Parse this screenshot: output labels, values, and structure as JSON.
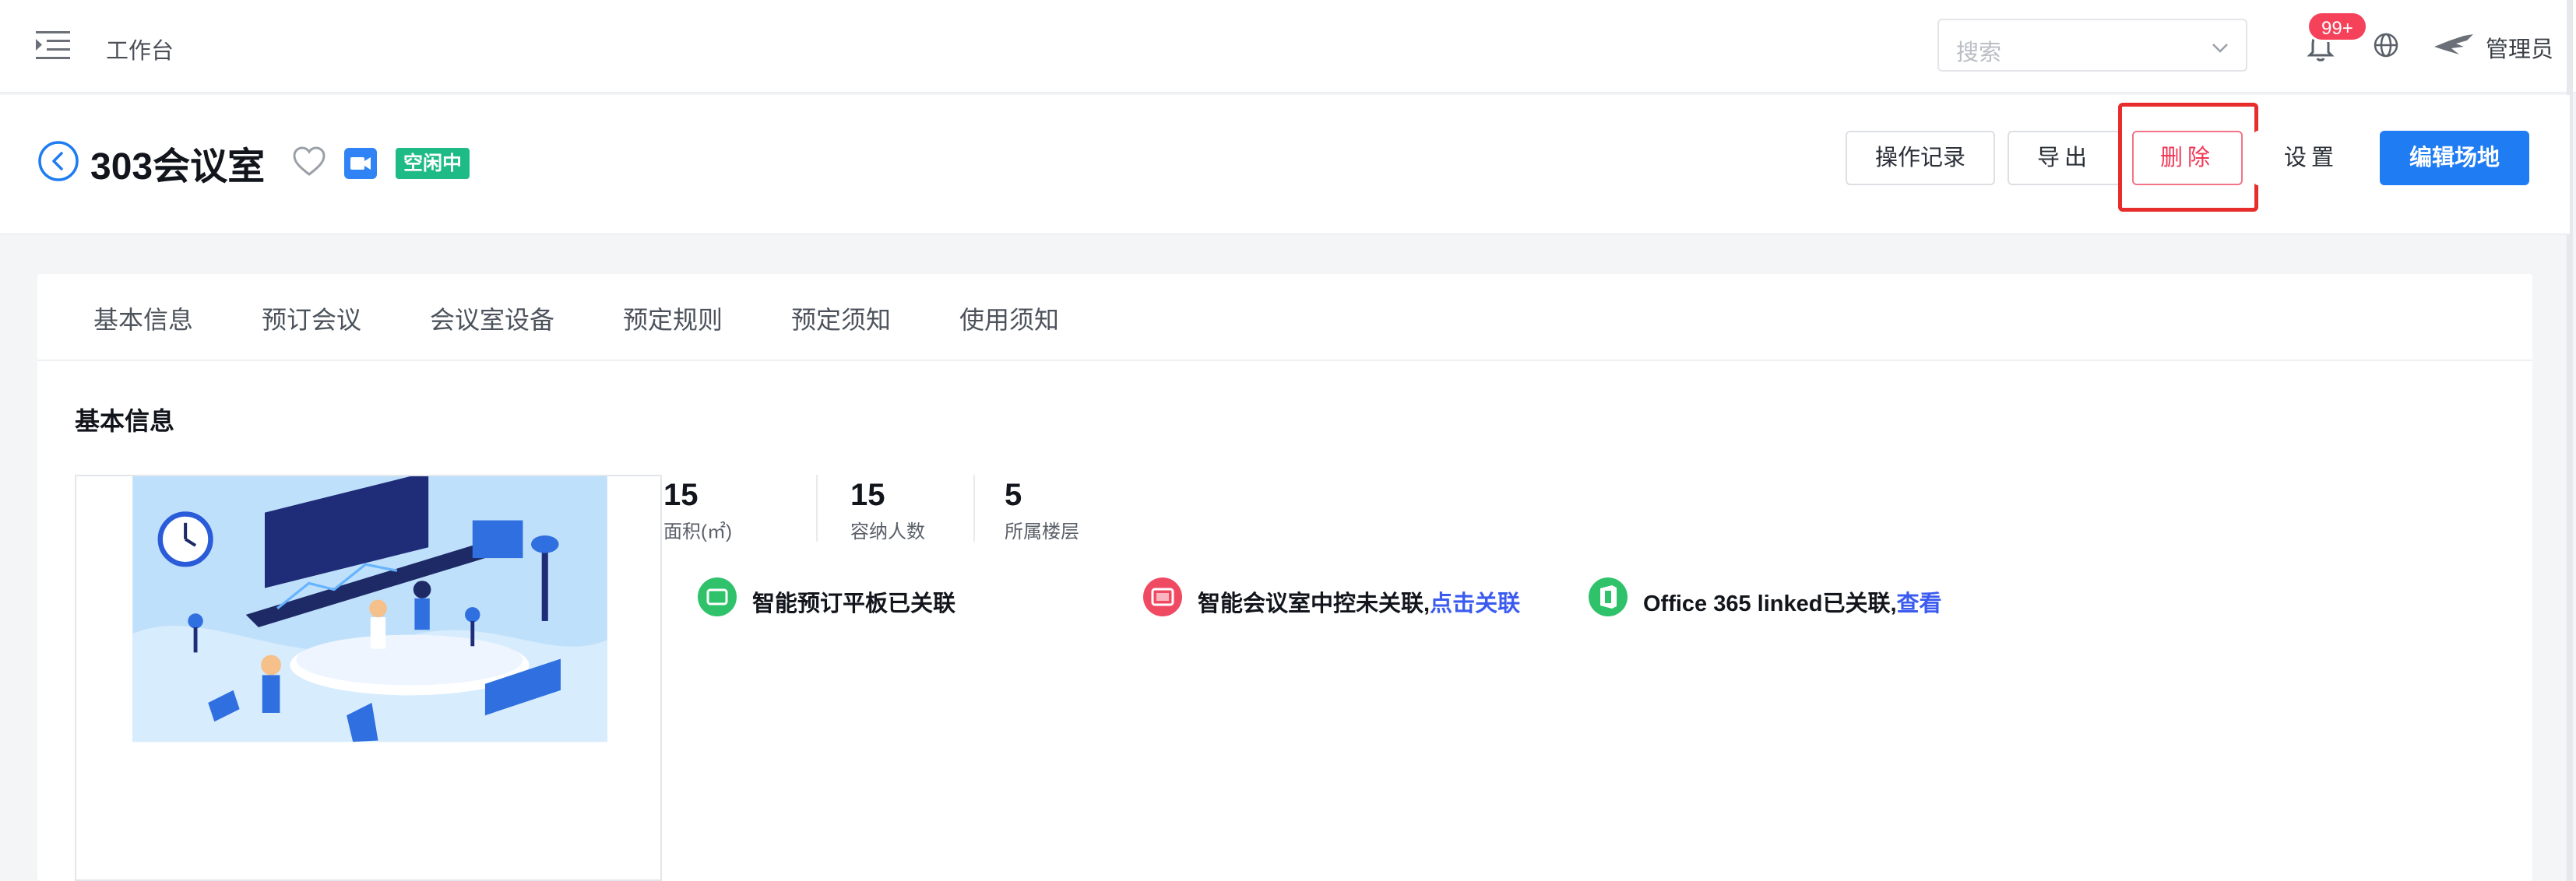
{
  "topbar": {
    "workbench_label": "工作台",
    "search_placeholder": "搜索",
    "notification_badge": "99+",
    "admin_name": "管理员"
  },
  "titlebar": {
    "room_title": "303会议室",
    "status": "空闲中",
    "buttons": {
      "log": "操作记录",
      "export": "导出",
      "delete": "删除",
      "settings": "设置",
      "edit": "编辑场地"
    }
  },
  "tabs": [
    "基本信息",
    "预订会议",
    "会议室设备",
    "预定规则",
    "预定须知",
    "使用须知"
  ],
  "basic_info": {
    "section_title": "基本信息",
    "stats": [
      {
        "value": "15",
        "label": "面积(㎡)"
      },
      {
        "value": "15",
        "label": "容纳人数"
      },
      {
        "value": "5",
        "label": "所属楼层"
      }
    ],
    "integrations": [
      {
        "text": "智能预订平板已关联",
        "link": "",
        "color": "#2fc26a"
      },
      {
        "text": "智能会议室中控未关联,",
        "link": "点击关联",
        "color": "#f04a63"
      },
      {
        "text": "Office 365 linked已关联,",
        "link": "查看",
        "color": "#2fc26a"
      }
    ]
  },
  "colors": {
    "primary": "#1f7cf2",
    "danger": "#f23656",
    "success": "#1fbb87"
  }
}
